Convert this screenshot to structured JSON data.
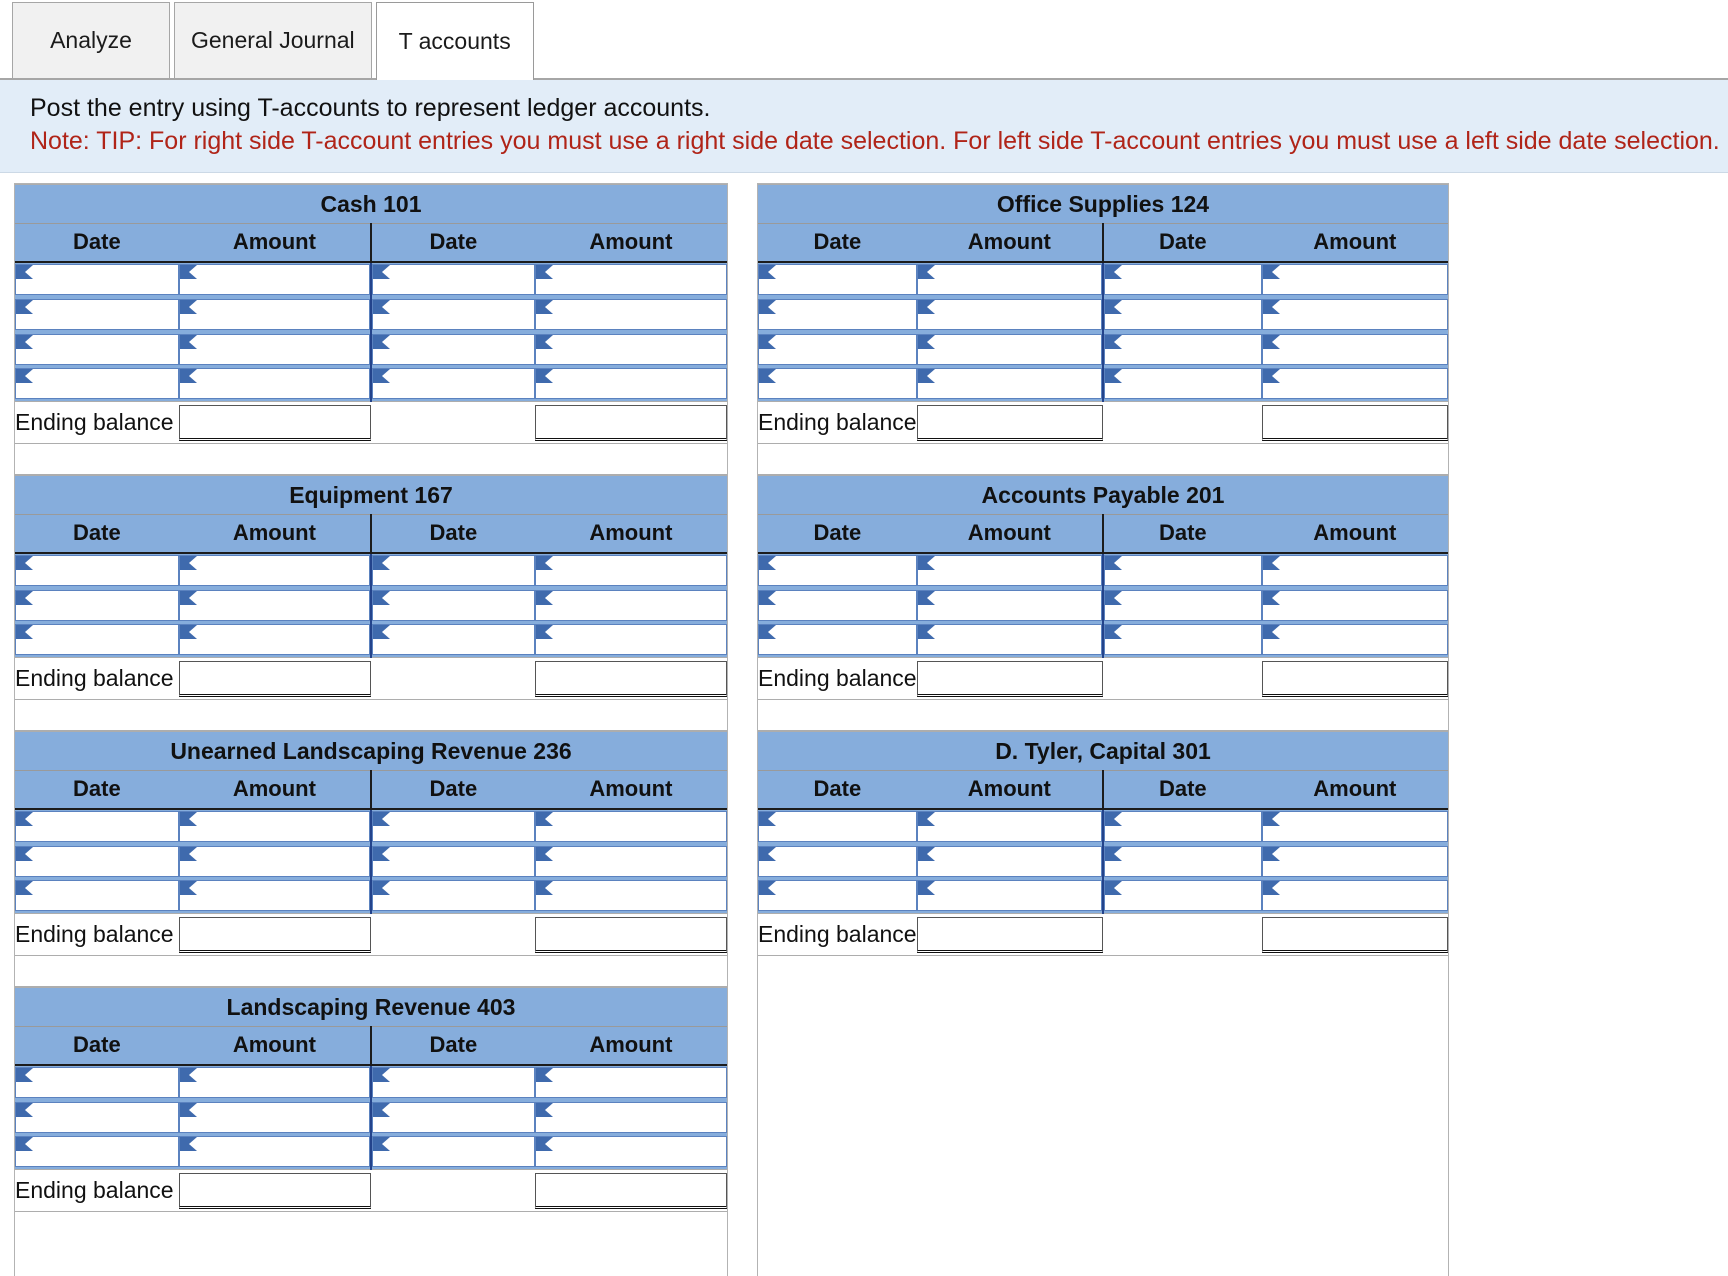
{
  "tabs": [
    {
      "label": "Analyze",
      "active": false
    },
    {
      "label": "General Journal",
      "active": false
    },
    {
      "label": "T accounts",
      "active": true
    }
  ],
  "banner": {
    "instruction": "Post the entry using T-accounts to represent ledger accounts.",
    "note": "Note: TIP: For right side T-account entries you must use a right side date selection. For left side T-account entries you must use a left side date selection.",
    "background_color": "#e2edf8",
    "note_color": "#b02418"
  },
  "labels": {
    "date": "Date",
    "amount": "Amount",
    "ending_balance": "Ending balance"
  },
  "colors": {
    "header_blue": "#86ADDC",
    "field_border": "#5b82bf",
    "marker_blue": "#3f6aad"
  },
  "columns": [
    "Date",
    "Amount",
    "Date",
    "Amount"
  ],
  "left_column_accounts": [
    {
      "title": "Cash 101",
      "rows": 4,
      "ending_balance": "Ending balance",
      "values": [
        [
          "",
          "",
          "",
          ""
        ],
        [
          "",
          "",
          "",
          ""
        ],
        [
          "",
          "",
          "",
          ""
        ],
        [
          "",
          "",
          "",
          ""
        ]
      ],
      "ending_values": [
        "",
        ""
      ]
    },
    {
      "title": "Equipment 167",
      "rows": 3,
      "ending_balance": "Ending balance",
      "values": [
        [
          "",
          "",
          "",
          ""
        ],
        [
          "",
          "",
          "",
          ""
        ],
        [
          "",
          "",
          "",
          ""
        ]
      ],
      "ending_values": [
        "",
        ""
      ]
    },
    {
      "title": "Unearned Landscaping Revenue 236",
      "rows": 3,
      "ending_balance": "Ending balance",
      "values": [
        [
          "",
          "",
          "",
          ""
        ],
        [
          "",
          "",
          "",
          ""
        ],
        [
          "",
          "",
          "",
          ""
        ]
      ],
      "ending_values": [
        "",
        ""
      ]
    },
    {
      "title": "Landscaping Revenue 403",
      "rows": 3,
      "ending_balance": "Ending balance",
      "values": [
        [
          "",
          "",
          "",
          ""
        ],
        [
          "",
          "",
          "",
          ""
        ],
        [
          "",
          "",
          "",
          ""
        ]
      ],
      "ending_values": [
        "",
        ""
      ]
    }
  ],
  "right_column_accounts": [
    {
      "title": "Office Supplies 124",
      "rows": 4,
      "ending_balance": "Ending balance",
      "values": [
        [
          "",
          "",
          "",
          ""
        ],
        [
          "",
          "",
          "",
          ""
        ],
        [
          "",
          "",
          "",
          ""
        ],
        [
          "",
          "",
          "",
          ""
        ]
      ],
      "ending_values": [
        "",
        ""
      ]
    },
    {
      "title": "Accounts Payable 201",
      "rows": 3,
      "ending_balance": "Ending balance",
      "values": [
        [
          "",
          "",
          "",
          ""
        ],
        [
          "",
          "",
          "",
          ""
        ],
        [
          "",
          "",
          "",
          ""
        ]
      ],
      "ending_values": [
        "",
        ""
      ]
    },
    {
      "title": "D. Tyler, Capital 301",
      "rows": 3,
      "ending_balance": "Ending balance",
      "values": [
        [
          "",
          "",
          "",
          ""
        ],
        [
          "",
          "",
          "",
          ""
        ],
        [
          "",
          "",
          "",
          ""
        ]
      ],
      "ending_values": [
        "",
        ""
      ]
    }
  ]
}
